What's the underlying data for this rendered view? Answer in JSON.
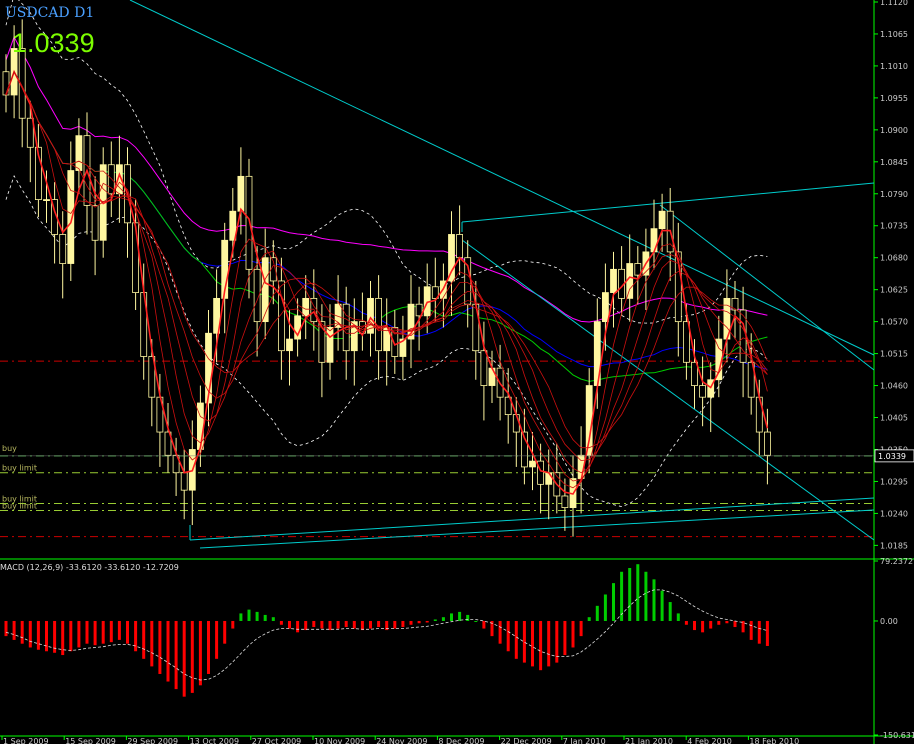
{
  "header": {
    "symbol": "USDCAD D1",
    "price": "1.0339"
  },
  "colors": {
    "background": "#000000",
    "axis": "#00ff00",
    "candle_up": "#fff7a0",
    "candle_down": "#000000",
    "candle_outline": "#fff7a0",
    "ma_red": "#ff0000",
    "ma_blue": "#0000ff",
    "ma_magenta": "#ff00ff",
    "ma_green": "#00cc00",
    "trendline": "#00cccc",
    "bands": "#ffffff",
    "buy_line": "#33cc33",
    "stop_line": "#cc0000",
    "macd_pos": "#00cc00",
    "macd_neg": "#ff0000"
  },
  "order_labels": [
    "buy",
    "buy limit",
    "buy limit",
    "buy limit"
  ],
  "chart_data": [
    {
      "type": "candlestick",
      "title": "USDCAD D1",
      "ylim": [
        1.0165,
        1.112
      ],
      "y_ticks": [
        "1.1120",
        "1.1065",
        "1.1010",
        "1.0955",
        "1.0900",
        "1.0845",
        "1.0790",
        "1.0735",
        "1.0680",
        "1.0625",
        "1.0570",
        "1.0515",
        "1.0460",
        "1.0405",
        "1.0350",
        "1.0295",
        "1.0240",
        "1.0185"
      ],
      "current_price_label": "1.0339",
      "x_ticks": [
        "1 Sep 2009",
        "15 Sep 2009",
        "29 Sep 2009",
        "13 Oct 2009",
        "27 Oct 2009",
        "10 Nov 2009",
        "24 Nov 2009",
        "8 Dec 2009",
        "22 Dec 2009",
        "7 Jan 2010",
        "21 Jan 2010",
        "4 Feb 2010",
        "18 Feb 2010"
      ],
      "series": [
        {
          "name": "close",
          "values": [
            1.096,
            1.104,
            1.092,
            1.087,
            1.078,
            1.078,
            1.072,
            1.067,
            1.083,
            1.089,
            1.077,
            1.071,
            1.084,
            1.079,
            1.084,
            1.074,
            1.062,
            1.051,
            1.044,
            1.038,
            1.034,
            1.031,
            1.028,
            1.035,
            1.043,
            1.055,
            1.061,
            1.071,
            1.076,
            1.082,
            1.066,
            1.057,
            1.068,
            1.064,
            1.052,
            1.054,
            1.058,
            1.061,
            1.057,
            1.05,
            1.056,
            1.06,
            1.052,
            1.057,
            1.055,
            1.061,
            1.052,
            1.056,
            1.051,
            1.054,
            1.06,
            1.058,
            1.063,
            1.061,
            1.064,
            1.072,
            1.068,
            1.06,
            1.052,
            1.046,
            1.049,
            1.044,
            1.041,
            1.038,
            1.032,
            1.033,
            1.029,
            1.031,
            1.027,
            1.025,
            1.03,
            1.034,
            1.046,
            1.057,
            1.062,
            1.066,
            1.061,
            1.067,
            1.065,
            1.069,
            1.073,
            1.076,
            1.069,
            1.057,
            1.05,
            1.046,
            1.044,
            1.047,
            1.054,
            1.061,
            1.059,
            1.05,
            1.044,
            1.038,
            1.034
          ]
        }
      ],
      "overlays": [
        "red ribbon MAs",
        "blue MA",
        "magenta MA",
        "green MA",
        "bollinger bands",
        "trend channels"
      ],
      "order_levels": [
        {
          "name": "buy",
          "value": 1.0339
        },
        {
          "name": "buy limit",
          "value": 1.031
        },
        {
          "name": "buy limit",
          "value": 1.0257
        },
        {
          "name": "buy limit",
          "value": 1.0245
        },
        {
          "name": "stop",
          "value": 1.0502
        },
        {
          "name": "stop",
          "value": 1.02
        }
      ],
      "grid": false
    },
    {
      "type": "bar",
      "title": "MACD (12,26,9) -33.6120 -33.6120 -12.7209",
      "ylim": [
        -150.631,
        79.2372
      ],
      "y_ticks": [
        "79.2372",
        "0.00",
        "-150.631"
      ],
      "series": [
        {
          "name": "histogram",
          "values": [
            -20,
            -25,
            -30,
            -35,
            -38,
            -40,
            -42,
            -45,
            -40,
            -35,
            -30,
            -32,
            -30,
            -28,
            -25,
            -30,
            -40,
            -50,
            -60,
            -70,
            -80,
            -90,
            -100,
            -95,
            -85,
            -70,
            -50,
            -30,
            -10,
            10,
            15,
            12,
            8,
            5,
            -5,
            -10,
            -15,
            -12,
            -8,
            -10,
            -12,
            -10,
            -8,
            -10,
            -12,
            -10,
            -8,
            -12,
            -10,
            -8,
            -5,
            -3,
            -2,
            2,
            5,
            10,
            12,
            8,
            0,
            -10,
            -20,
            -30,
            -40,
            -50,
            -55,
            -60,
            -65,
            -60,
            -55,
            -45,
            -35,
            -20,
            5,
            20,
            35,
            50,
            65,
            70,
            75,
            65,
            55,
            40,
            25,
            10,
            -5,
            -12,
            -15,
            -10,
            -5,
            -3,
            -8,
            -15,
            -25,
            -30,
            -33
          ]
        },
        {
          "name": "signal",
          "values": [
            -15,
            -18,
            -22,
            -27,
            -30,
            -33,
            -36,
            -38,
            -39,
            -38,
            -36,
            -35,
            -34,
            -32,
            -31,
            -31,
            -33,
            -37,
            -42,
            -48,
            -55,
            -62,
            -70,
            -75,
            -78,
            -77,
            -72,
            -64,
            -54,
            -43,
            -32,
            -23,
            -17,
            -12,
            -10,
            -10,
            -11,
            -11,
            -11,
            -11,
            -11,
            -11,
            -10,
            -10,
            -11,
            -11,
            -10,
            -10,
            -10,
            -10,
            -9,
            -8,
            -7,
            -5,
            -3,
            -1,
            1,
            2,
            2,
            0,
            -3,
            -8,
            -14,
            -21,
            -28,
            -34,
            -40,
            -44,
            -47,
            -47,
            -46,
            -41,
            -33,
            -24,
            -14,
            -3,
            9,
            20,
            30,
            37,
            41,
            41,
            38,
            33,
            26,
            19,
            13,
            8,
            4,
            2,
            0,
            -2,
            -6,
            -10,
            -12.7
          ]
        }
      ]
    }
  ]
}
